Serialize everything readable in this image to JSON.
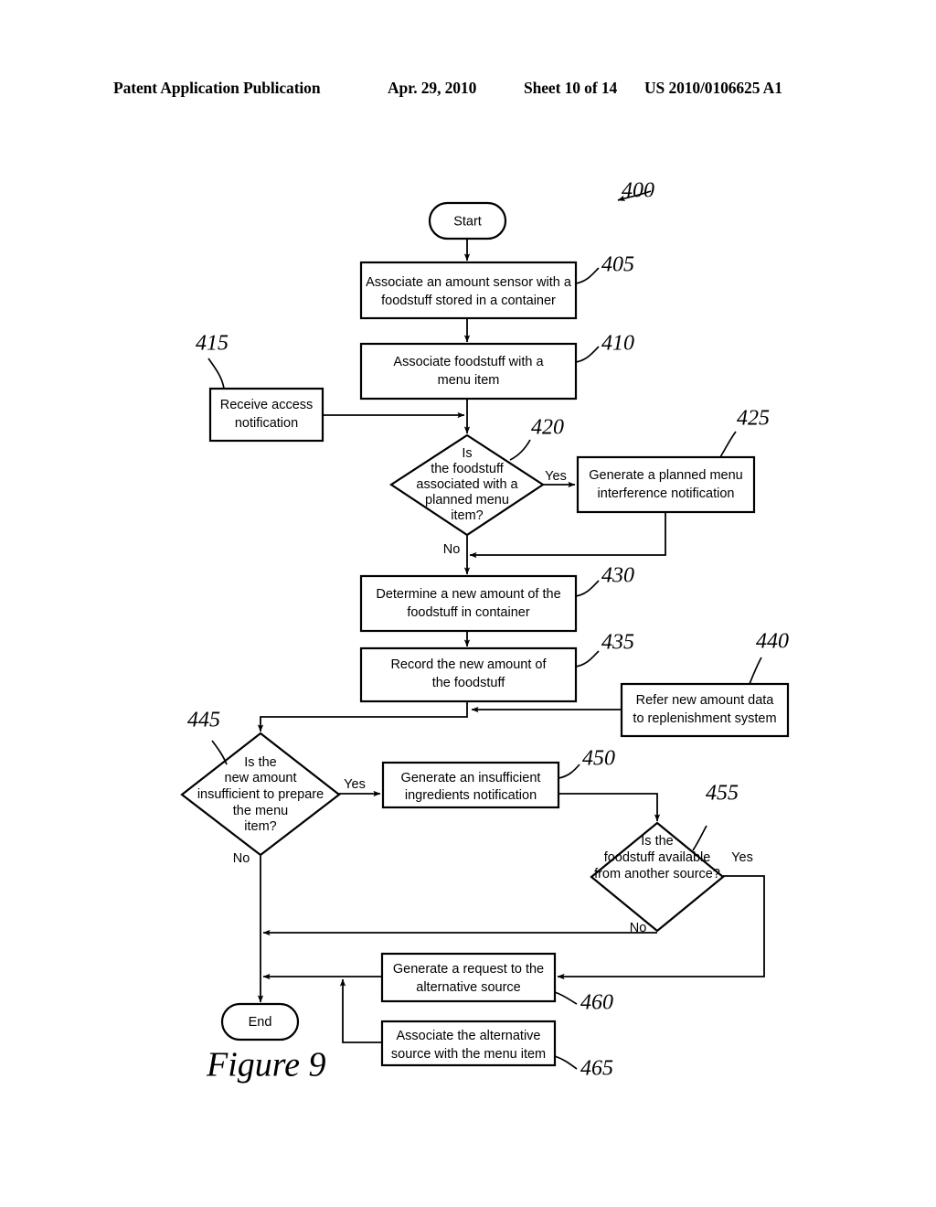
{
  "header": {
    "publication": "Patent Application Publication",
    "date": "Apr. 29, 2010",
    "sheet": "Sheet 10 of 14",
    "patent_number": "US 2010/0106625 A1"
  },
  "figure": {
    "caption": "Figure 9",
    "diagram_ref": "400"
  },
  "nodes": {
    "start": {
      "label": "Start",
      "shape": "terminator"
    },
    "end": {
      "label": "End",
      "shape": "terminator"
    },
    "n405": {
      "ref": "405",
      "line1": "Associate an amount sensor with a",
      "line2": "foodstuff stored in a container",
      "shape": "process"
    },
    "n410": {
      "ref": "410",
      "line1": "Associate foodstuff with a",
      "line2": "menu item",
      "shape": "process"
    },
    "n415": {
      "ref": "415",
      "line1": "Receive access",
      "line2": "notification",
      "shape": "process"
    },
    "n420": {
      "ref": "420",
      "shape": "decision",
      "line1": "Is",
      "line2": "the foodstuff",
      "line3": "associated with a",
      "line4": "planned menu",
      "line5": "item?"
    },
    "n425": {
      "ref": "425",
      "line1": "Generate a planned menu",
      "line2": "interference notification",
      "shape": "process"
    },
    "n430": {
      "ref": "430",
      "line1": "Determine a new amount of the",
      "line2": "foodstuff in container",
      "shape": "process"
    },
    "n435": {
      "ref": "435",
      "line1": "Record the new amount of",
      "line2": "the foodstuff",
      "shape": "process"
    },
    "n440": {
      "ref": "440",
      "line1": "Refer new amount data",
      "line2": "to replenishment system",
      "shape": "process"
    },
    "n445": {
      "ref": "445",
      "shape": "decision",
      "line1": "Is the",
      "line2": "new amount",
      "line3": "insufficient to prepare",
      "line4": "the menu",
      "line5": "item?"
    },
    "n450": {
      "ref": "450",
      "line1": "Generate an insufficient",
      "line2": "ingredients notification",
      "shape": "process"
    },
    "n455": {
      "ref": "455",
      "shape": "decision",
      "line1": "Is the",
      "line2": "foodstuff available",
      "line3": "from another source?"
    },
    "n460": {
      "ref": "460",
      "line1": "Generate a request to the",
      "line2": "alternative source",
      "shape": "process"
    },
    "n465": {
      "ref": "465",
      "line1": "Associate the alternative",
      "line2": "source with the menu item",
      "shape": "process"
    }
  },
  "edge_labels": {
    "d420_yes": "Yes",
    "d420_no": "No",
    "d445_yes": "Yes",
    "d445_no": "No",
    "d455_yes": "Yes",
    "d455_no": "No"
  },
  "colors": {
    "stroke": "#000000",
    "fill": "#ffffff",
    "text": "#000000"
  }
}
